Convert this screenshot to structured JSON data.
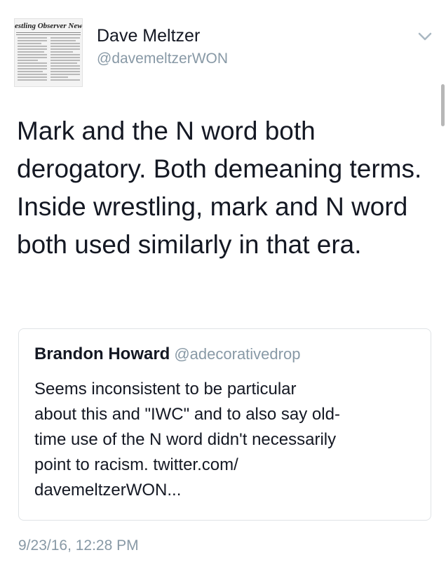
{
  "author": {
    "display_name": "Dave Meltzer",
    "handle": "@davemeltzerWON",
    "avatar_text": "estling Observer Newslet"
  },
  "tweet": {
    "text": "Mark and the N word both derogatory.  Both demeaning terms.  Inside wrestling, mark and N word both used similarly in that era.",
    "timestamp": "9/23/16, 12:28 PM"
  },
  "quoted_tweet": {
    "display_name": "Brandon Howard",
    "handle": "@adecorativedrop",
    "text": "Seems inconsistent to be particular\nabout this and \"IWC\" and to also say old-\ntime use of the N word didn't necessarily\npoint to racism. twitter.com/\ndavemeltzerWON..."
  },
  "icons": {
    "menu": "chevron-down-icon"
  },
  "colors": {
    "text": "#141823",
    "secondary": "#8899a6",
    "border": "#dfe3e6"
  }
}
